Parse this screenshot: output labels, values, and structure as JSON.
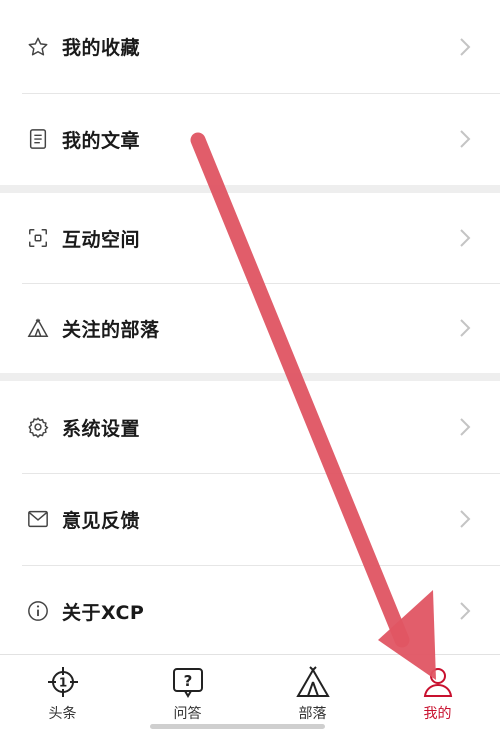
{
  "menu": {
    "group1": [
      {
        "label": "我的收藏",
        "icon": "star-icon"
      },
      {
        "label": "我的文章",
        "icon": "document-icon"
      }
    ],
    "group2": [
      {
        "label": "互动空间",
        "icon": "interaction-space-icon"
      },
      {
        "label": "关注的部落",
        "icon": "tent-icon"
      }
    ],
    "group3": [
      {
        "label": "系统设置",
        "icon": "gear-icon"
      },
      {
        "label": "意见反馈",
        "icon": "mail-icon"
      },
      {
        "label": "关于XCP",
        "icon": "info-icon"
      }
    ]
  },
  "tabbar": {
    "tabs": [
      {
        "label": "头条",
        "icon": "target-icon"
      },
      {
        "label": "问答",
        "icon": "question-bubble-icon"
      },
      {
        "label": "部落",
        "icon": "tent-icon"
      },
      {
        "label": "我的",
        "icon": "user-icon",
        "active": true
      }
    ]
  },
  "colors": {
    "accent": "#c8102e",
    "annotation_arrow": "#e05563",
    "divider": "#e6e6e6",
    "section_gap": "#eeeeee"
  }
}
